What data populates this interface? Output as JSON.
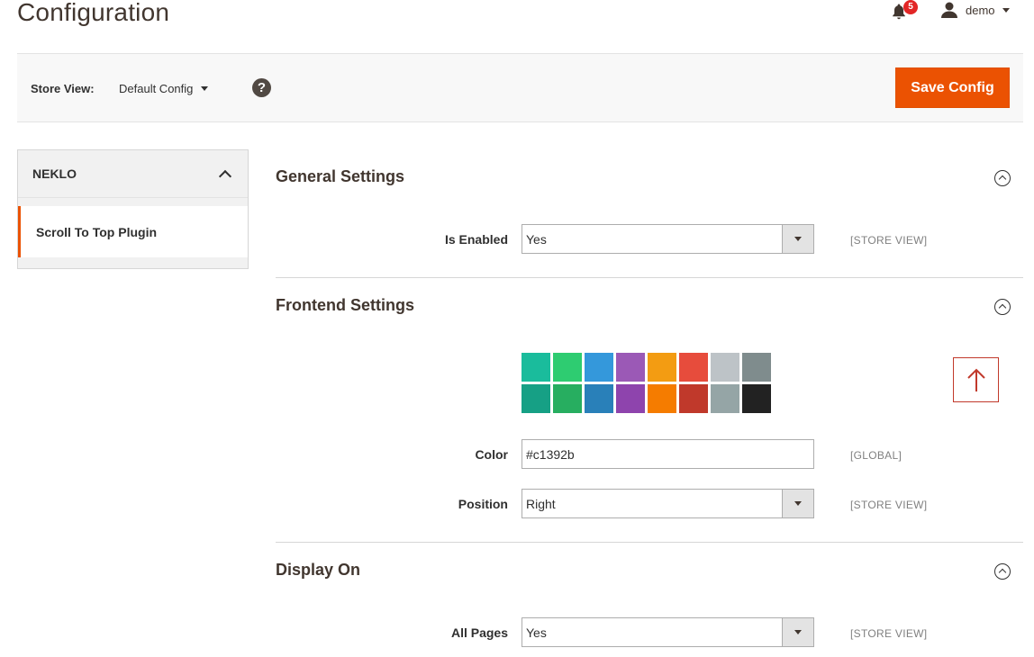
{
  "header": {
    "page_title": "Configuration",
    "notifications_count": "5",
    "user_name": "demo"
  },
  "store_bar": {
    "label": "Store View:",
    "selected": "Default Config",
    "help": "?",
    "save_label": "Save Config"
  },
  "sidebar": {
    "group_title": "NEKLO",
    "items": [
      {
        "label": "Scroll To Top Plugin",
        "active": true
      }
    ]
  },
  "sections": {
    "general": {
      "title": "General Settings",
      "is_enabled_label": "Is Enabled",
      "is_enabled_value": "Yes",
      "is_enabled_scope": "[STORE VIEW]"
    },
    "frontend": {
      "title": "Frontend Settings",
      "swatches": [
        "#1abc9c",
        "#2ecc71",
        "#3498db",
        "#9b59b6",
        "#f39c12",
        "#e74c3c",
        "#bdc3c7",
        "#7f8c8d",
        "#16a085",
        "#27ae60",
        "#2980b9",
        "#8e44ad",
        "#f57c00",
        "#c0392b",
        "#95a5a6",
        "#222222"
      ],
      "preview_color": "#c1392b",
      "color_label": "Color",
      "color_value": "#c1392b",
      "color_scope": "[GLOBAL]",
      "position_label": "Position",
      "position_value": "Right",
      "position_scope": "[STORE VIEW]"
    },
    "display_on": {
      "title": "Display On",
      "all_pages_label": "All Pages",
      "all_pages_value": "Yes",
      "all_pages_scope": "[STORE VIEW]"
    }
  },
  "colors": {
    "accent": "#eb5202",
    "text": "#303030"
  }
}
